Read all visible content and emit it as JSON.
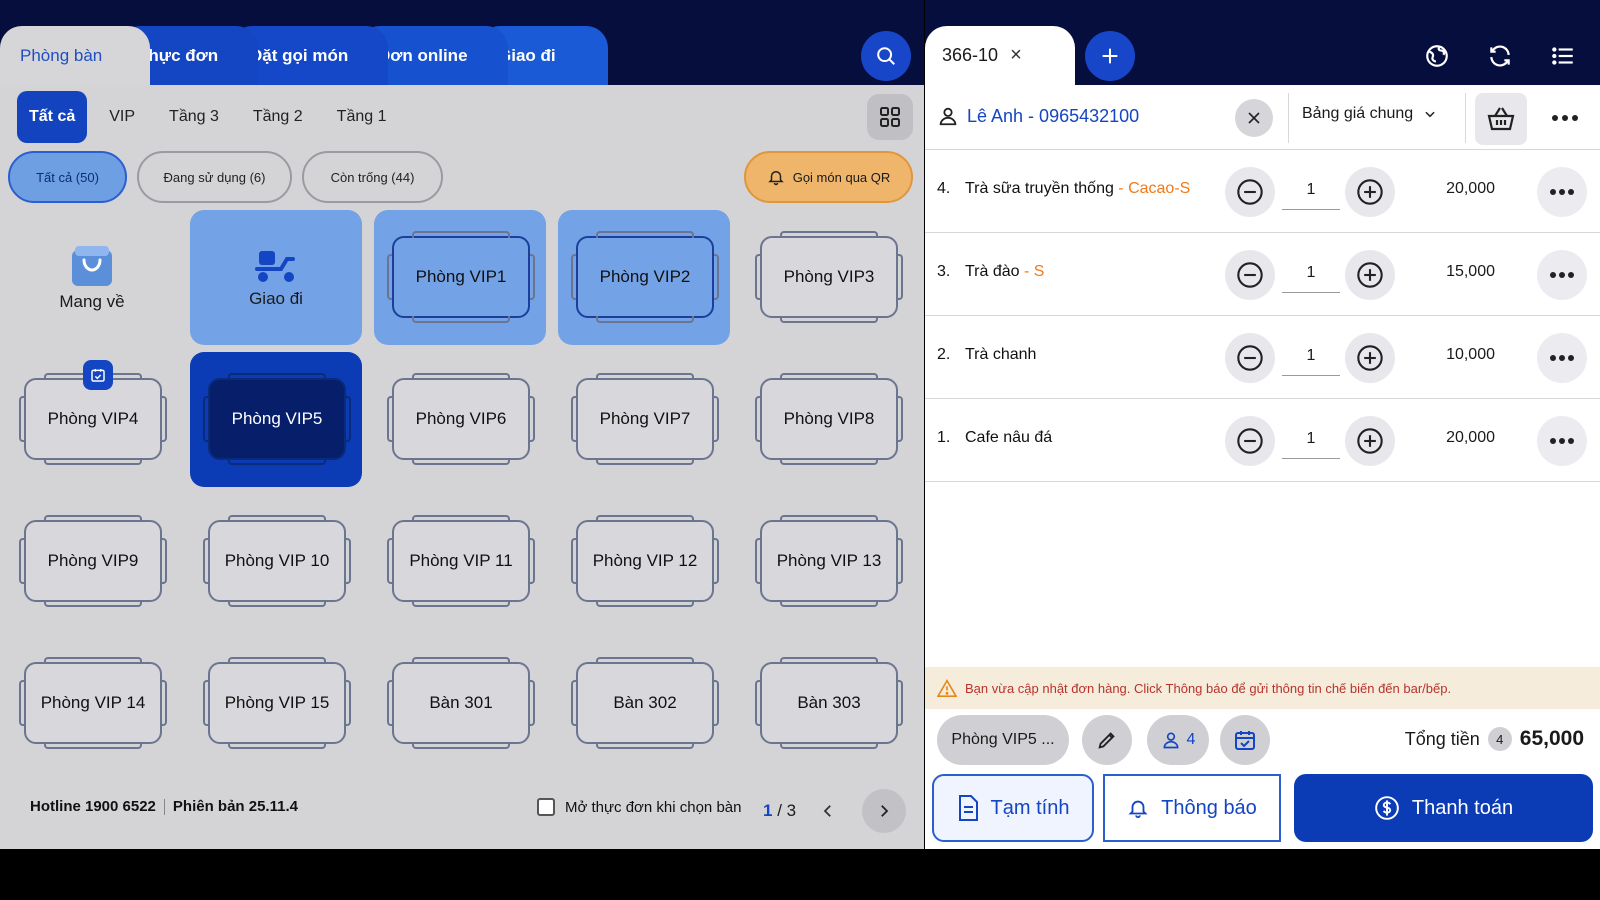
{
  "left_tabs": [
    "Phòng bàn",
    "Thực đơn",
    "Đặt gọi món",
    "Đơn online",
    "Giao đi"
  ],
  "floors": [
    "Tất cả",
    "VIP",
    "Tầng 3",
    "Tầng 2",
    "Tầng 1"
  ],
  "filters": [
    "Tất cả (50)",
    "Đang sử dụng (6)",
    "Còn trống (44)"
  ],
  "qr_label": "Gọi món qua QR",
  "special": {
    "takeaway": "Mang về",
    "delivery": "Giao đi"
  },
  "tables": {
    "r1": [
      "Phòng VIP1",
      "Phòng VIP2",
      "Phòng VIP3"
    ],
    "r2": [
      "Phòng VIP4",
      "Phòng VIP5",
      "Phòng VIP6",
      "Phòng VIP7",
      "Phòng VIP8"
    ],
    "r3": [
      "Phòng VIP9",
      "Phòng VIP 10",
      "Phòng VIP 11",
      "Phòng VIP 12",
      "Phòng VIP 13"
    ],
    "r4": [
      "Phòng VIP 14",
      "Phòng VIP 15",
      "Bàn 301",
      "Bàn 302",
      "Bàn 303"
    ]
  },
  "footer": {
    "hotline": "Hotline 1900 6522",
    "version": "Phiên bản 25.11.4",
    "open_menu": "Mở thực đơn khi chọn bàn",
    "page_current": "1",
    "page_total": "3"
  },
  "order": {
    "tab": "366-10",
    "customer": "Lê Anh - 0965432100",
    "price_list": "Bảng giá chung",
    "items": [
      {
        "num": "4.",
        "name": "Trà sữa truyền thống",
        "variant": " - Cacao-S",
        "qty": "1",
        "amount": "20,000"
      },
      {
        "num": "3.",
        "name": "Trà đào",
        "variant": " - S",
        "qty": "1",
        "amount": "15,000"
      },
      {
        "num": "2.",
        "name": "Trà chanh",
        "variant": "",
        "qty": "1",
        "amount": "10,000"
      },
      {
        "num": "1.",
        "name": "Cafe nâu đá",
        "variant": "",
        "qty": "1",
        "amount": "20,000"
      }
    ],
    "warning": "Bạn vừa cập nhật đơn hàng. Click Thông báo để gửi thông tin chế biến đến bar/bếp.",
    "room": "Phòng VIP5 ...",
    "guests": "4",
    "total_label": "Tổng tiền",
    "total_count": "4",
    "total_value": "65,000"
  },
  "actions": {
    "provisional": "Tạm tính",
    "notify": "Thông báo",
    "pay": "Thanh toán"
  },
  "colors": {
    "navy": "#060e3e",
    "primary": "#1445c2",
    "selected_light": "#73a3e6",
    "selected_dark": "#0b3cb6",
    "accent_orange": "#ef7a1b"
  }
}
